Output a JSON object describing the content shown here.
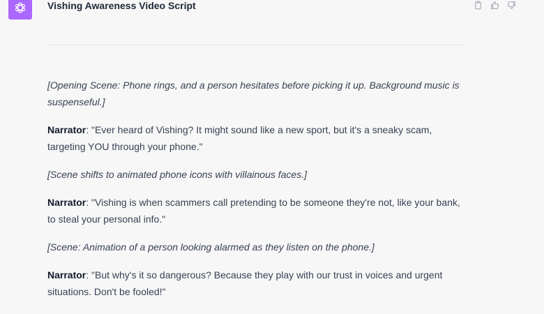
{
  "header": {
    "title": "Vishing Awareness Video Script"
  },
  "colors": {
    "avatar_bg": "#ab68ff",
    "background": "#f7f7f8"
  },
  "icons": {
    "avatar": "openai-logo-icon",
    "actions": [
      "clipboard-icon",
      "thumbs-up-icon",
      "thumbs-down-icon"
    ]
  },
  "script": [
    {
      "type": "stage",
      "text": "[Opening Scene: Phone rings, and a person hesitates before picking it up. Background music is suspenseful.]"
    },
    {
      "type": "dialogue",
      "speaker": "Narrator",
      "text": ": \"Ever heard of Vishing? It might sound like a new sport, but it's a sneaky scam, targeting YOU through your phone.\""
    },
    {
      "type": "stage",
      "text": "[Scene shifts to animated phone icons with villainous faces.]"
    },
    {
      "type": "dialogue",
      "speaker": "Narrator",
      "text": ": \"Vishing is when scammers call pretending to be someone they're not, like your bank, to steal your personal info.\""
    },
    {
      "type": "stage",
      "text": "[Scene: Animation of a person looking alarmed as they listen on the phone.]"
    },
    {
      "type": "dialogue",
      "speaker": "Narrator",
      "text": ": \"But why's it so dangerous? Because they play with our trust in voices and urgent situations. Don't be fooled!\""
    }
  ]
}
